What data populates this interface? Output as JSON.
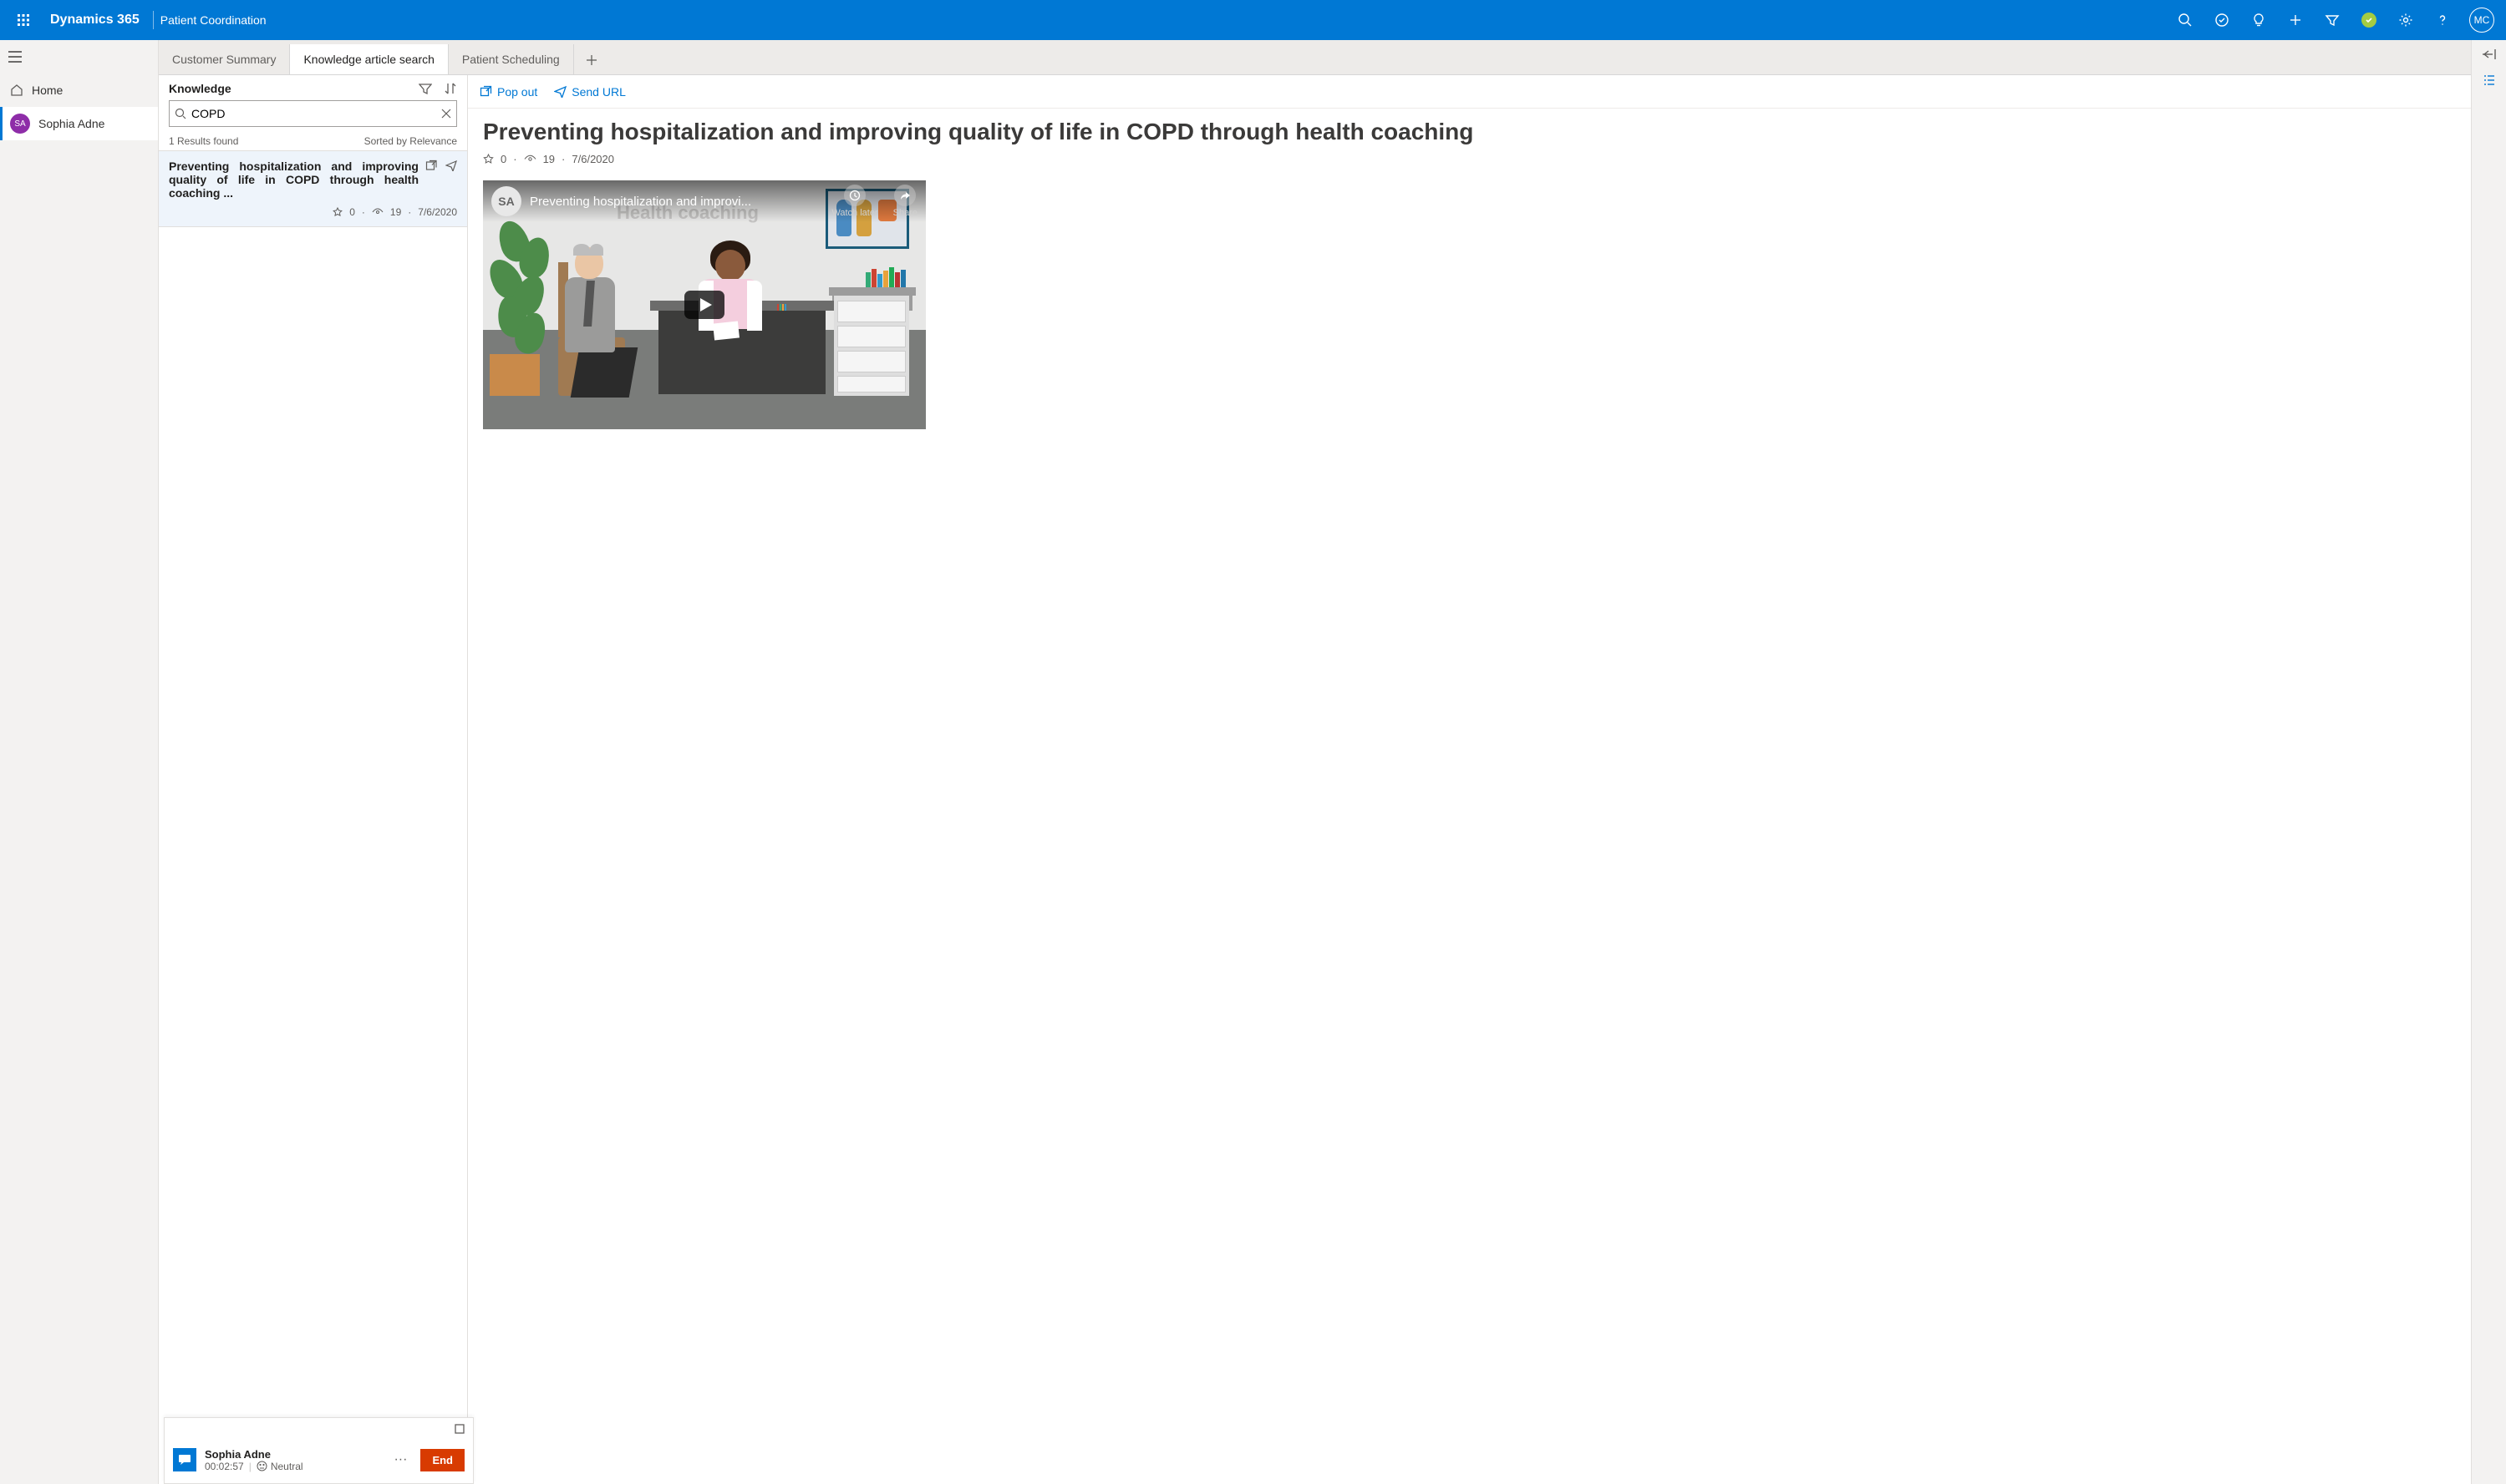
{
  "topbar": {
    "product": "Dynamics 365",
    "app": "Patient Coordination",
    "user_initials": "MC"
  },
  "leftnav": {
    "home_label": "Home",
    "person_initials": "SA",
    "person_name": "Sophia Adne"
  },
  "tabs": [
    {
      "label": "Customer Summary",
      "active": false
    },
    {
      "label": "Knowledge article search",
      "active": true
    },
    {
      "label": "Patient Scheduling",
      "active": false
    }
  ],
  "knowledge": {
    "heading": "Knowledge",
    "search_value": "COPD",
    "results_count_text": "1 Results found",
    "sorted_text": "Sorted by Relevance",
    "result": {
      "title": "Preventing hospitalization and improving quality of life in COPD through health coaching  ...",
      "rating": "0",
      "views": "19",
      "date": "7/6/2020"
    }
  },
  "article": {
    "actions": {
      "popout": "Pop out",
      "sendurl": "Send URL"
    },
    "title": "Preventing hospitalization and improving quality of life in COPD through health coaching",
    "rating": "0",
    "views": "19",
    "date": "7/6/2020",
    "video": {
      "avatar_initials": "SA",
      "title": "Preventing hospitalization and improvi...",
      "watch_later": "Watch later",
      "share": "Share",
      "caption": "Health coaching"
    }
  },
  "chat": {
    "name": "Sophia Adne",
    "timer": "00:02:57",
    "sentiment": "Neutral",
    "end_label": "End"
  }
}
